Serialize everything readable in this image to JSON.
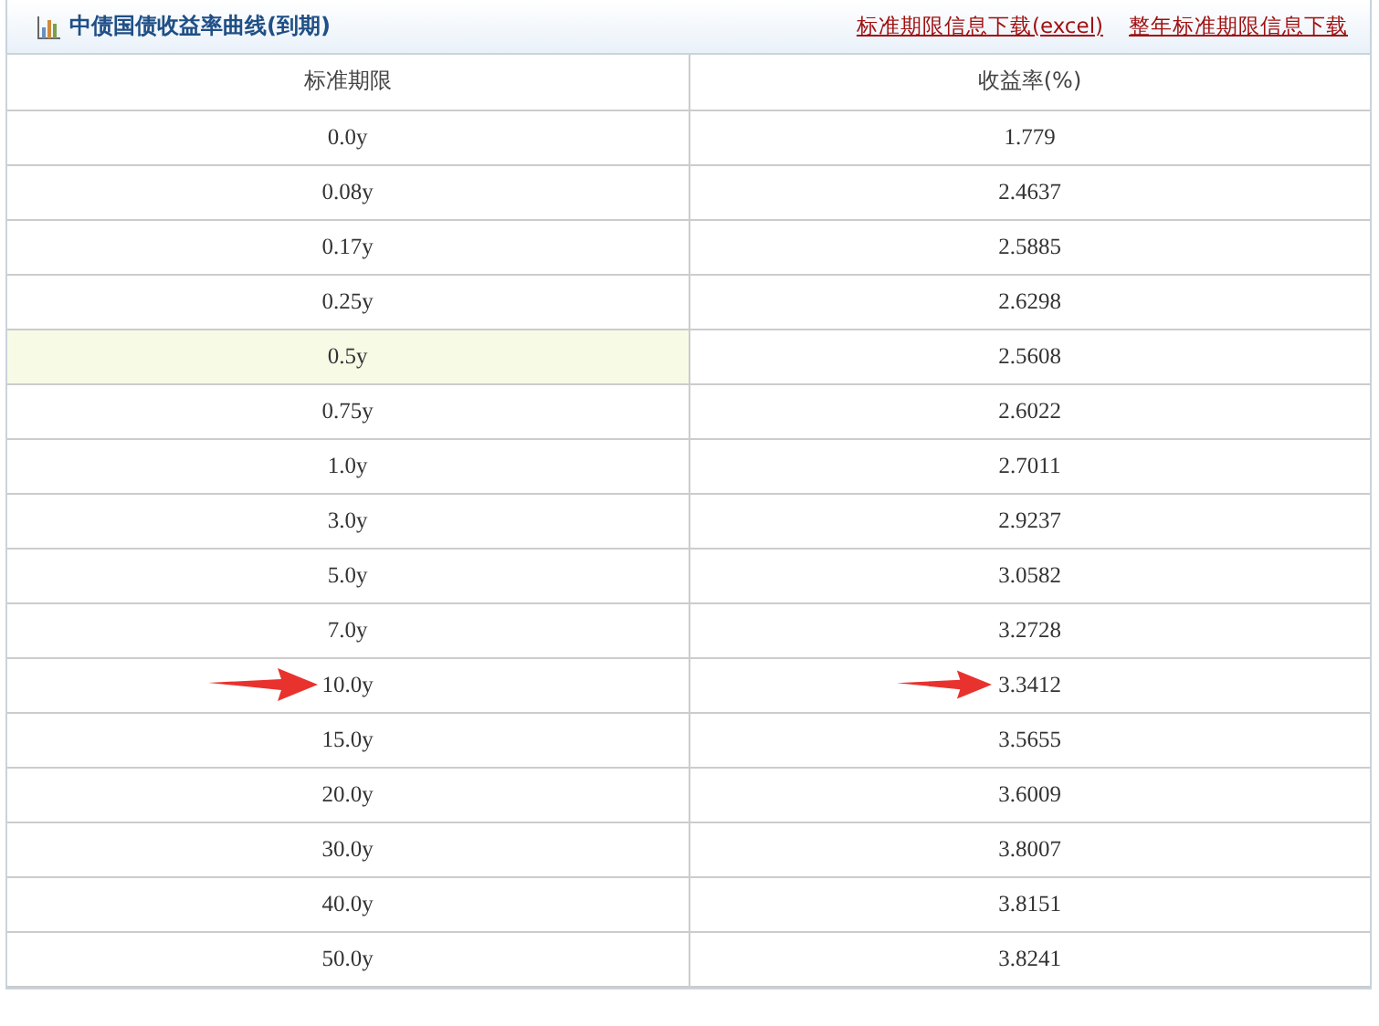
{
  "panel": {
    "title": "中债国债收益率曲线(到期)",
    "links": [
      "标准期限信息下载(excel)",
      "整年标准期限信息下载"
    ]
  },
  "table": {
    "columns": [
      "标准期限",
      "收益率(%)"
    ],
    "rows": [
      {
        "term": "0.0y",
        "yield": "1.779",
        "selected": false,
        "marked": false
      },
      {
        "term": "0.08y",
        "yield": "2.4637",
        "selected": false,
        "marked": false
      },
      {
        "term": "0.17y",
        "yield": "2.5885",
        "selected": false,
        "marked": false
      },
      {
        "term": "0.25y",
        "yield": "2.6298",
        "selected": false,
        "marked": false
      },
      {
        "term": "0.5y",
        "yield": "2.5608",
        "selected": true,
        "marked": false
      },
      {
        "term": "0.75y",
        "yield": "2.6022",
        "selected": false,
        "marked": false
      },
      {
        "term": "1.0y",
        "yield": "2.7011",
        "selected": false,
        "marked": false
      },
      {
        "term": "3.0y",
        "yield": "2.9237",
        "selected": false,
        "marked": false
      },
      {
        "term": "5.0y",
        "yield": "3.0582",
        "selected": false,
        "marked": false
      },
      {
        "term": "7.0y",
        "yield": "3.2728",
        "selected": false,
        "marked": false
      },
      {
        "term": "10.0y",
        "yield": "3.3412",
        "selected": false,
        "marked": true
      },
      {
        "term": "15.0y",
        "yield": "3.5655",
        "selected": false,
        "marked": false
      },
      {
        "term": "20.0y",
        "yield": "3.6009",
        "selected": false,
        "marked": false
      },
      {
        "term": "30.0y",
        "yield": "3.8007",
        "selected": false,
        "marked": false
      },
      {
        "term": "40.0y",
        "yield": "3.8151",
        "selected": false,
        "marked": false
      },
      {
        "term": "50.0y",
        "yield": "3.8241",
        "selected": false,
        "marked": false
      }
    ]
  }
}
